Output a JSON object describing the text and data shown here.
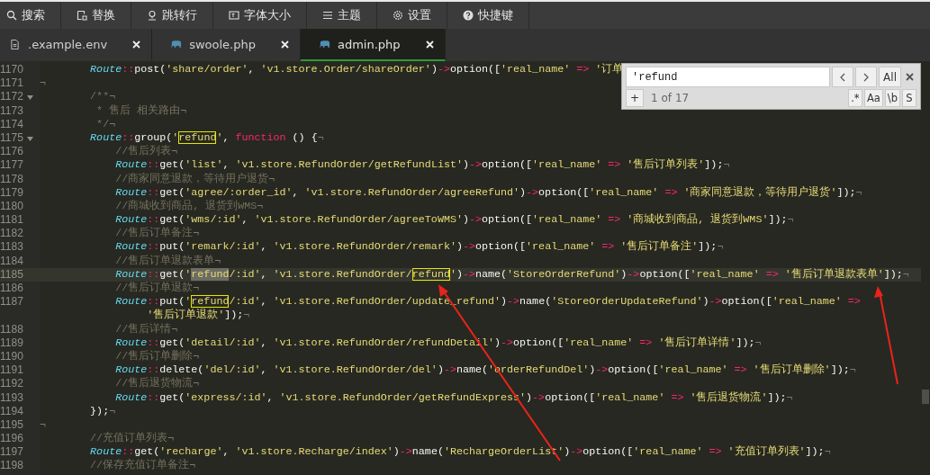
{
  "toolbar": [
    {
      "label": "搜索",
      "kind": "search"
    },
    {
      "label": "替换",
      "kind": "replace"
    },
    {
      "label": "跳转行",
      "kind": "goto"
    },
    {
      "label": "字体大小",
      "kind": "font"
    },
    {
      "label": "主题",
      "kind": "theme"
    },
    {
      "label": "设置",
      "kind": "settings"
    },
    {
      "label": "快捷键",
      "kind": "help"
    }
  ],
  "tabs": [
    {
      "label": ".example.env",
      "kind": "file",
      "selected": false
    },
    {
      "label": "swoole.php",
      "kind": "php",
      "selected": false
    },
    {
      "label": "admin.php",
      "kind": "php",
      "selected": true
    }
  ],
  "search_panel": {
    "value": "'refund",
    "all_button": "All",
    "add_button": "+",
    "status": "1 of 17",
    "options": [
      ".*",
      "Aa",
      "\\b",
      "S"
    ]
  },
  "lines": [
    {
      "number": "1170",
      "fold": false,
      "current": false,
      "tokens": [
        {
          "kind": "cls",
          "text": "        Route"
        },
        {
          "kind": "op",
          "text": "::"
        },
        {
          "kind": "fn",
          "text": "post("
        },
        {
          "kind": "str",
          "text": "'share/order'"
        },
        {
          "kind": "fn",
          "text": ", "
        },
        {
          "kind": "str",
          "text": "'v1.store.Order/shareOrder'"
        },
        {
          "kind": "fn",
          "text": ")"
        },
        {
          "kind": "op",
          "text": "->"
        },
        {
          "kind": "fn",
          "text": "option(["
        },
        {
          "kind": "str",
          "text": "'real_name'"
        },
        {
          "kind": "op",
          "text": " => "
        },
        {
          "kind": "str",
          "text": "'订单"
        }
      ]
    },
    {
      "number": "1171",
      "fold": false,
      "current": false,
      "tokens": [
        {
          "kind": "eol",
          "text": "¬"
        }
      ]
    },
    {
      "number": "1172",
      "fold": true,
      "current": false,
      "tokens": [
        {
          "kind": "comment",
          "text": "        /**"
        },
        {
          "kind": "eol",
          "text": "¬"
        }
      ]
    },
    {
      "number": "1173",
      "fold": false,
      "current": false,
      "tokens": [
        {
          "kind": "comment",
          "text": "         * 售后 相关路由"
        },
        {
          "kind": "eol",
          "text": "¬"
        }
      ]
    },
    {
      "number": "1174",
      "fold": false,
      "current": false,
      "tokens": [
        {
          "kind": "comment",
          "text": "         */"
        },
        {
          "kind": "eol",
          "text": "¬"
        }
      ]
    },
    {
      "number": "1175",
      "fold": true,
      "current": false,
      "tokens": [
        {
          "kind": "cls",
          "text": "        Route"
        },
        {
          "kind": "op",
          "text": "::"
        },
        {
          "kind": "fn",
          "text": "group("
        },
        {
          "kind": "str",
          "text": "'"
        },
        {
          "kind": "match",
          "text": "refund"
        },
        {
          "kind": "str",
          "text": "'"
        },
        {
          "kind": "fn",
          "text": ", "
        },
        {
          "kind": "keyword",
          "text": "function"
        },
        {
          "kind": "fn",
          "text": " () {"
        },
        {
          "kind": "eol",
          "text": "¬"
        }
      ]
    },
    {
      "number": "1176",
      "fold": false,
      "current": false,
      "tokens": [
        {
          "kind": "comment",
          "text": "            //售后列表"
        },
        {
          "kind": "eol",
          "text": "¬"
        }
      ]
    },
    {
      "number": "1177",
      "fold": false,
      "current": false,
      "tokens": [
        {
          "kind": "cls",
          "text": "            Route"
        },
        {
          "kind": "op",
          "text": "::"
        },
        {
          "kind": "fn",
          "text": "get("
        },
        {
          "kind": "str",
          "text": "'list'"
        },
        {
          "kind": "fn",
          "text": ", "
        },
        {
          "kind": "str",
          "text": "'v1.store.RefundOrder/getRefundList'"
        },
        {
          "kind": "fn",
          "text": ")"
        },
        {
          "kind": "op",
          "text": "->"
        },
        {
          "kind": "fn",
          "text": "option(["
        },
        {
          "kind": "str",
          "text": "'real_name'"
        },
        {
          "kind": "op",
          "text": " => "
        },
        {
          "kind": "str",
          "text": "'售后订单列表'"
        },
        {
          "kind": "fn",
          "text": "]);"
        },
        {
          "kind": "eol",
          "text": "¬"
        }
      ]
    },
    {
      "number": "1178",
      "fold": false,
      "current": false,
      "tokens": [
        {
          "kind": "comment",
          "text": "            //商家同意退款，等待用户退货"
        },
        {
          "kind": "eol",
          "text": "¬"
        }
      ]
    },
    {
      "number": "1179",
      "fold": false,
      "current": false,
      "tokens": [
        {
          "kind": "cls",
          "text": "            Route"
        },
        {
          "kind": "op",
          "text": "::"
        },
        {
          "kind": "fn",
          "text": "get("
        },
        {
          "kind": "str",
          "text": "'agree/:order_id'"
        },
        {
          "kind": "fn",
          "text": ", "
        },
        {
          "kind": "str",
          "text": "'v1.store.RefundOrder/agreeRefund'"
        },
        {
          "kind": "fn",
          "text": ")"
        },
        {
          "kind": "op",
          "text": "->"
        },
        {
          "kind": "fn",
          "text": "option(["
        },
        {
          "kind": "str",
          "text": "'real_name'"
        },
        {
          "kind": "op",
          "text": " => "
        },
        {
          "kind": "str",
          "text": "'商家同意退款，等待用户退货'"
        },
        {
          "kind": "fn",
          "text": "]);"
        },
        {
          "kind": "eol",
          "text": "¬"
        }
      ]
    },
    {
      "number": "1180",
      "fold": false,
      "current": false,
      "tokens": [
        {
          "kind": "comment",
          "text": "            //商城收到商品, 退货到WMS"
        },
        {
          "kind": "eol",
          "text": "¬"
        }
      ]
    },
    {
      "number": "1181",
      "fold": false,
      "current": false,
      "tokens": [
        {
          "kind": "cls",
          "text": "            Route"
        },
        {
          "kind": "op",
          "text": "::"
        },
        {
          "kind": "fn",
          "text": "get("
        },
        {
          "kind": "str",
          "text": "'wms/:id'"
        },
        {
          "kind": "fn",
          "text": ", "
        },
        {
          "kind": "str",
          "text": "'v1.store.RefundOrder/agreeToWMS'"
        },
        {
          "kind": "fn",
          "text": ")"
        },
        {
          "kind": "op",
          "text": "->"
        },
        {
          "kind": "fn",
          "text": "option(["
        },
        {
          "kind": "str",
          "text": "'real_name'"
        },
        {
          "kind": "op",
          "text": " => "
        },
        {
          "kind": "str",
          "text": "'商城收到商品, 退货到WMS'"
        },
        {
          "kind": "fn",
          "text": "]);"
        },
        {
          "kind": "eol",
          "text": "¬"
        }
      ]
    },
    {
      "number": "1182",
      "fold": false,
      "current": false,
      "tokens": [
        {
          "kind": "comment",
          "text": "            //售后订单备注"
        },
        {
          "kind": "eol",
          "text": "¬"
        }
      ]
    },
    {
      "number": "1183",
      "fold": false,
      "current": false,
      "tokens": [
        {
          "kind": "cls",
          "text": "            Route"
        },
        {
          "kind": "op",
          "text": "::"
        },
        {
          "kind": "fn",
          "text": "put("
        },
        {
          "kind": "str",
          "text": "'remark/:id'"
        },
        {
          "kind": "fn",
          "text": ", "
        },
        {
          "kind": "str",
          "text": "'v1.store.RefundOrder/remark'"
        },
        {
          "kind": "fn",
          "text": ")"
        },
        {
          "kind": "op",
          "text": "->"
        },
        {
          "kind": "fn",
          "text": "option(["
        },
        {
          "kind": "str",
          "text": "'real_name'"
        },
        {
          "kind": "op",
          "text": " => "
        },
        {
          "kind": "str",
          "text": "'售后订单备注'"
        },
        {
          "kind": "fn",
          "text": "]);"
        },
        {
          "kind": "eol",
          "text": "¬"
        }
      ]
    },
    {
      "number": "1184",
      "fold": false,
      "current": false,
      "tokens": [
        {
          "kind": "comment",
          "text": "            //售后订单退款表单"
        },
        {
          "kind": "eol",
          "text": "¬"
        }
      ]
    },
    {
      "number": "1185",
      "fold": false,
      "current": true,
      "tokens": [
        {
          "kind": "cls",
          "text": "            Route"
        },
        {
          "kind": "op",
          "text": "::"
        },
        {
          "kind": "fn",
          "text": "get("
        },
        {
          "kind": "str",
          "text": "'"
        },
        {
          "kind": "current_match",
          "text": "refund"
        },
        {
          "kind": "str",
          "text": "/:id'"
        },
        {
          "kind": "fn",
          "text": ", "
        },
        {
          "kind": "str",
          "text": "'v1.store.RefundOrder/"
        },
        {
          "kind": "match",
          "text": "refund"
        },
        {
          "kind": "str",
          "text": "'"
        },
        {
          "kind": "fn",
          "text": ")"
        },
        {
          "kind": "op",
          "text": "->"
        },
        {
          "kind": "fn",
          "text": "name("
        },
        {
          "kind": "str",
          "text": "'StoreOrderRefund'"
        },
        {
          "kind": "fn",
          "text": ")"
        },
        {
          "kind": "op",
          "text": "->"
        },
        {
          "kind": "fn",
          "text": "option(["
        },
        {
          "kind": "str",
          "text": "'real_name'"
        },
        {
          "kind": "op",
          "text": " => "
        },
        {
          "kind": "str",
          "text": "'售后订单退款表单'"
        },
        {
          "kind": "fn",
          "text": "]);"
        },
        {
          "kind": "eol",
          "text": "¬"
        }
      ]
    },
    {
      "number": "1186",
      "fold": false,
      "current": false,
      "tokens": [
        {
          "kind": "comment",
          "text": "            //售后订单退款"
        },
        {
          "kind": "eol",
          "text": "¬"
        }
      ]
    },
    {
      "number": "1187",
      "fold": false,
      "current": false,
      "tokens": [
        {
          "kind": "cls",
          "text": "            Route"
        },
        {
          "kind": "op",
          "text": "::"
        },
        {
          "kind": "fn",
          "text": "put("
        },
        {
          "kind": "str",
          "text": "'"
        },
        {
          "kind": "match",
          "text": "refund"
        },
        {
          "kind": "str",
          "text": "/:id'"
        },
        {
          "kind": "fn",
          "text": ", "
        },
        {
          "kind": "str",
          "text": "'v1.store.RefundOrder/update_refund'"
        },
        {
          "kind": "fn",
          "text": ")"
        },
        {
          "kind": "op",
          "text": "->"
        },
        {
          "kind": "fn",
          "text": "name("
        },
        {
          "kind": "str",
          "text": "'StoreOrderUpdateRefund'"
        },
        {
          "kind": "fn",
          "text": ")"
        },
        {
          "kind": "op",
          "text": "->"
        },
        {
          "kind": "fn",
          "text": "option(["
        },
        {
          "kind": "str",
          "text": "'real_name'"
        },
        {
          "kind": "op",
          "text": " =>"
        }
      ],
      "wrap": [
        {
          "kind": "str",
          "text": "                 '售后订单退款'"
        },
        {
          "kind": "fn",
          "text": "]);"
        },
        {
          "kind": "eol",
          "text": "¬"
        }
      ]
    },
    {
      "number": "1188",
      "fold": false,
      "current": false,
      "tokens": [
        {
          "kind": "comment",
          "text": "            //售后详情"
        },
        {
          "kind": "eol",
          "text": "¬"
        }
      ]
    },
    {
      "number": "1189",
      "fold": false,
      "current": false,
      "tokens": [
        {
          "kind": "cls",
          "text": "            Route"
        },
        {
          "kind": "op",
          "text": "::"
        },
        {
          "kind": "fn",
          "text": "get("
        },
        {
          "kind": "str",
          "text": "'detail/:id'"
        },
        {
          "kind": "fn",
          "text": ", "
        },
        {
          "kind": "str",
          "text": "'v1.store.RefundOrder/refundDetail'"
        },
        {
          "kind": "fn",
          "text": ")"
        },
        {
          "kind": "op",
          "text": "->"
        },
        {
          "kind": "fn",
          "text": "option(["
        },
        {
          "kind": "str",
          "text": "'real_name'"
        },
        {
          "kind": "op",
          "text": " => "
        },
        {
          "kind": "str",
          "text": "'售后订单详情'"
        },
        {
          "kind": "fn",
          "text": "]);"
        },
        {
          "kind": "eol",
          "text": "¬"
        }
      ]
    },
    {
      "number": "1190",
      "fold": false,
      "current": false,
      "tokens": [
        {
          "kind": "comment",
          "text": "            //售后订单删除"
        },
        {
          "kind": "eol",
          "text": "¬"
        }
      ]
    },
    {
      "number": "1191",
      "fold": false,
      "current": false,
      "tokens": [
        {
          "kind": "cls",
          "text": "            Route"
        },
        {
          "kind": "op",
          "text": "::"
        },
        {
          "kind": "fn",
          "text": "delete("
        },
        {
          "kind": "str",
          "text": "'del/:id'"
        },
        {
          "kind": "fn",
          "text": ", "
        },
        {
          "kind": "str",
          "text": "'v1.store.RefundOrder/del'"
        },
        {
          "kind": "fn",
          "text": ")"
        },
        {
          "kind": "op",
          "text": "->"
        },
        {
          "kind": "fn",
          "text": "name("
        },
        {
          "kind": "str",
          "text": "'orderRefundDel'"
        },
        {
          "kind": "fn",
          "text": ")"
        },
        {
          "kind": "op",
          "text": "->"
        },
        {
          "kind": "fn",
          "text": "option(["
        },
        {
          "kind": "str",
          "text": "'real_name'"
        },
        {
          "kind": "op",
          "text": " => "
        },
        {
          "kind": "str",
          "text": "'售后订单删除'"
        },
        {
          "kind": "fn",
          "text": "]);"
        },
        {
          "kind": "eol",
          "text": "¬"
        }
      ]
    },
    {
      "number": "1192",
      "fold": false,
      "current": false,
      "tokens": [
        {
          "kind": "comment",
          "text": "            //售后退货物流"
        },
        {
          "kind": "eol",
          "text": "¬"
        }
      ]
    },
    {
      "number": "1193",
      "fold": false,
      "current": false,
      "tokens": [
        {
          "kind": "cls",
          "text": "            Route"
        },
        {
          "kind": "op",
          "text": "::"
        },
        {
          "kind": "fn",
          "text": "get("
        },
        {
          "kind": "str",
          "text": "'express/:id'"
        },
        {
          "kind": "fn",
          "text": ", "
        },
        {
          "kind": "str",
          "text": "'v1.store.RefundOrder/getRefundExpress'"
        },
        {
          "kind": "fn",
          "text": ")"
        },
        {
          "kind": "op",
          "text": "->"
        },
        {
          "kind": "fn",
          "text": "option(["
        },
        {
          "kind": "str",
          "text": "'real_name'"
        },
        {
          "kind": "op",
          "text": " => "
        },
        {
          "kind": "str",
          "text": "'售后退货物流'"
        },
        {
          "kind": "fn",
          "text": "]);"
        },
        {
          "kind": "eol",
          "text": "¬"
        }
      ]
    },
    {
      "number": "1194",
      "fold": false,
      "current": false,
      "tokens": [
        {
          "kind": "fn",
          "text": "        });"
        },
        {
          "kind": "eol",
          "text": "¬"
        }
      ]
    },
    {
      "number": "1195",
      "fold": false,
      "current": false,
      "tokens": [
        {
          "kind": "eol",
          "text": "¬"
        }
      ]
    },
    {
      "number": "1196",
      "fold": false,
      "current": false,
      "tokens": [
        {
          "kind": "comment",
          "text": "        //充值订单列表"
        },
        {
          "kind": "eol",
          "text": "¬"
        }
      ]
    },
    {
      "number": "1197",
      "fold": false,
      "current": false,
      "tokens": [
        {
          "kind": "cls",
          "text": "        Route"
        },
        {
          "kind": "op",
          "text": "::"
        },
        {
          "kind": "fn",
          "text": "get("
        },
        {
          "kind": "str",
          "text": "'recharge'"
        },
        {
          "kind": "fn",
          "text": ", "
        },
        {
          "kind": "str",
          "text": "'v1.store.Recharge/index'"
        },
        {
          "kind": "fn",
          "text": ")"
        },
        {
          "kind": "op",
          "text": "->"
        },
        {
          "kind": "fn",
          "text": "name("
        },
        {
          "kind": "str",
          "text": "'RechargeOrderList'"
        },
        {
          "kind": "fn",
          "text": ")"
        },
        {
          "kind": "op",
          "text": "->"
        },
        {
          "kind": "fn",
          "text": "option(["
        },
        {
          "kind": "str",
          "text": "'real_name'"
        },
        {
          "kind": "op",
          "text": " => "
        },
        {
          "kind": "str",
          "text": "'充值订单列表'"
        },
        {
          "kind": "fn",
          "text": "]);"
        },
        {
          "kind": "eol",
          "text": "¬"
        }
      ]
    },
    {
      "number": "1198",
      "fold": false,
      "current": false,
      "tokens": [
        {
          "kind": "comment",
          "text": "        //保存充值订单备注"
        },
        {
          "kind": "eol",
          "text": "¬"
        }
      ]
    }
  ]
}
